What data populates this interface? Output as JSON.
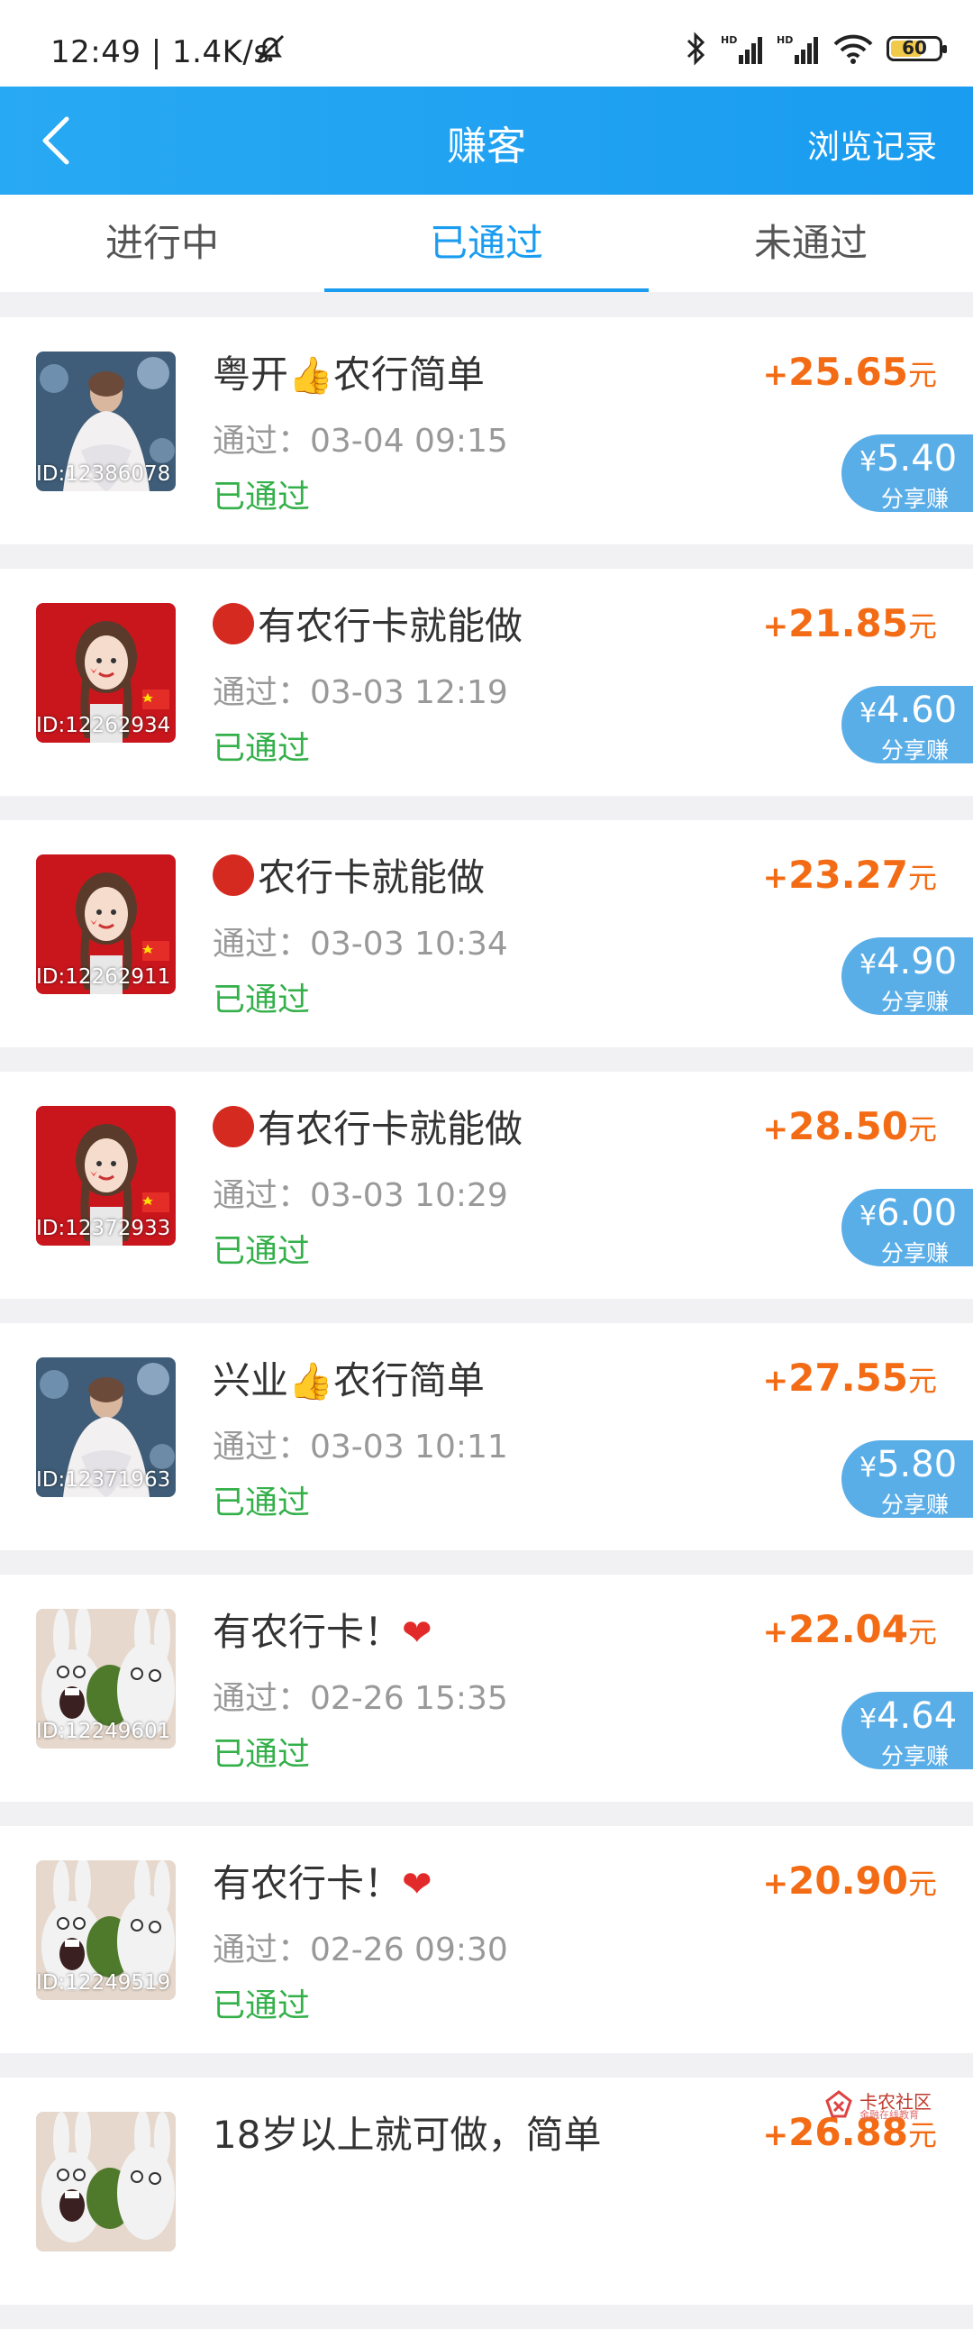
{
  "status_bar": {
    "time": "12:49 | 1.4K/s",
    "battery": "60"
  },
  "header": {
    "title": "赚客",
    "history": "浏览记录"
  },
  "tabs": [
    {
      "label": "进行中",
      "active": false
    },
    {
      "label": "已通过",
      "active": true
    },
    {
      "label": "未通过",
      "active": false
    }
  ],
  "items": [
    {
      "id": "ID:12386078",
      "title": "粤开👍农行简单",
      "time": "通过：03-04 09:15",
      "status": "已通过",
      "amount": "25.65",
      "share": "5.40",
      "avatar": "lady-white"
    },
    {
      "id": "ID:12262934",
      "title": "🔴有农行卡就能做",
      "time": "通过：03-03 12:19",
      "status": "已通过",
      "amount": "21.85",
      "share": "4.60",
      "avatar": "girl-red"
    },
    {
      "id": "ID:12262911",
      "title": "🔴农行卡就能做",
      "time": "通过：03-03 10:34",
      "status": "已通过",
      "amount": "23.27",
      "share": "4.90",
      "avatar": "girl-red"
    },
    {
      "id": "ID:12372933",
      "title": "🔴有农行卡就能做",
      "time": "通过：03-03 10:29",
      "status": "已通过",
      "amount": "28.50",
      "share": "6.00",
      "avatar": "girl-red"
    },
    {
      "id": "ID:12371963",
      "title": "兴业👍农行简单",
      "time": "通过：03-03 10:11",
      "status": "已通过",
      "amount": "27.55",
      "share": "5.80",
      "avatar": "lady-white"
    },
    {
      "id": "ID:12249601",
      "title": "有农行卡！❤️",
      "time": "通过：02-26 15:35",
      "status": "已通过",
      "amount": "22.04",
      "share": "4.64",
      "avatar": "rabbit"
    },
    {
      "id": "ID:12249519",
      "title": "有农行卡！❤️",
      "time": "通过：02-26 09:30",
      "status": "已通过",
      "amount": "20.90",
      "share": null,
      "avatar": "rabbit"
    },
    {
      "id": "",
      "title": "18岁以上就可做，简单",
      "time": "",
      "status": "",
      "amount": "26.88",
      "share": null,
      "avatar": "rabbit"
    }
  ],
  "labels": {
    "plus": "+",
    "unit": "元",
    "yen": "¥",
    "share_label": "分享赚"
  },
  "watermark": {
    "text": "卡农社区",
    "sub": "金融在线教育"
  },
  "colors": {
    "brand": "#1a9cf0",
    "amount": "#f36c15",
    "approved": "#34b04a",
    "share_bg": "#5aaee8"
  }
}
